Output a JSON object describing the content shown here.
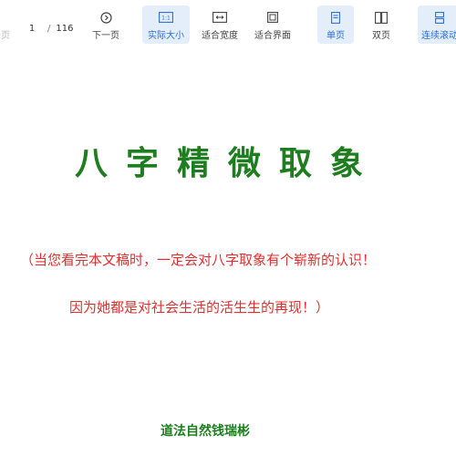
{
  "toolbar": {
    "prev_label": "一页",
    "page_current": "1",
    "page_separator": "/",
    "page_total": "116",
    "next_label": "下一页",
    "actual_size_label": "实际大小",
    "fit_width_label": "适合宽度",
    "fit_page_label": "适合界面",
    "single_page_label": "单页",
    "double_page_label": "双页",
    "continuous_label": "连续滚动",
    "accent_color": "#2b6fd6"
  },
  "document": {
    "title": "八字精微取象",
    "line1": "（当您看完本文稿时，一定会对八字取象有个崭新的认识！",
    "line2": "因为她都是对社会生活的活生生的再现！）",
    "author": "道法自然钱瑞彬",
    "title_color": "#1e7d1e",
    "body_color": "#e03030"
  }
}
